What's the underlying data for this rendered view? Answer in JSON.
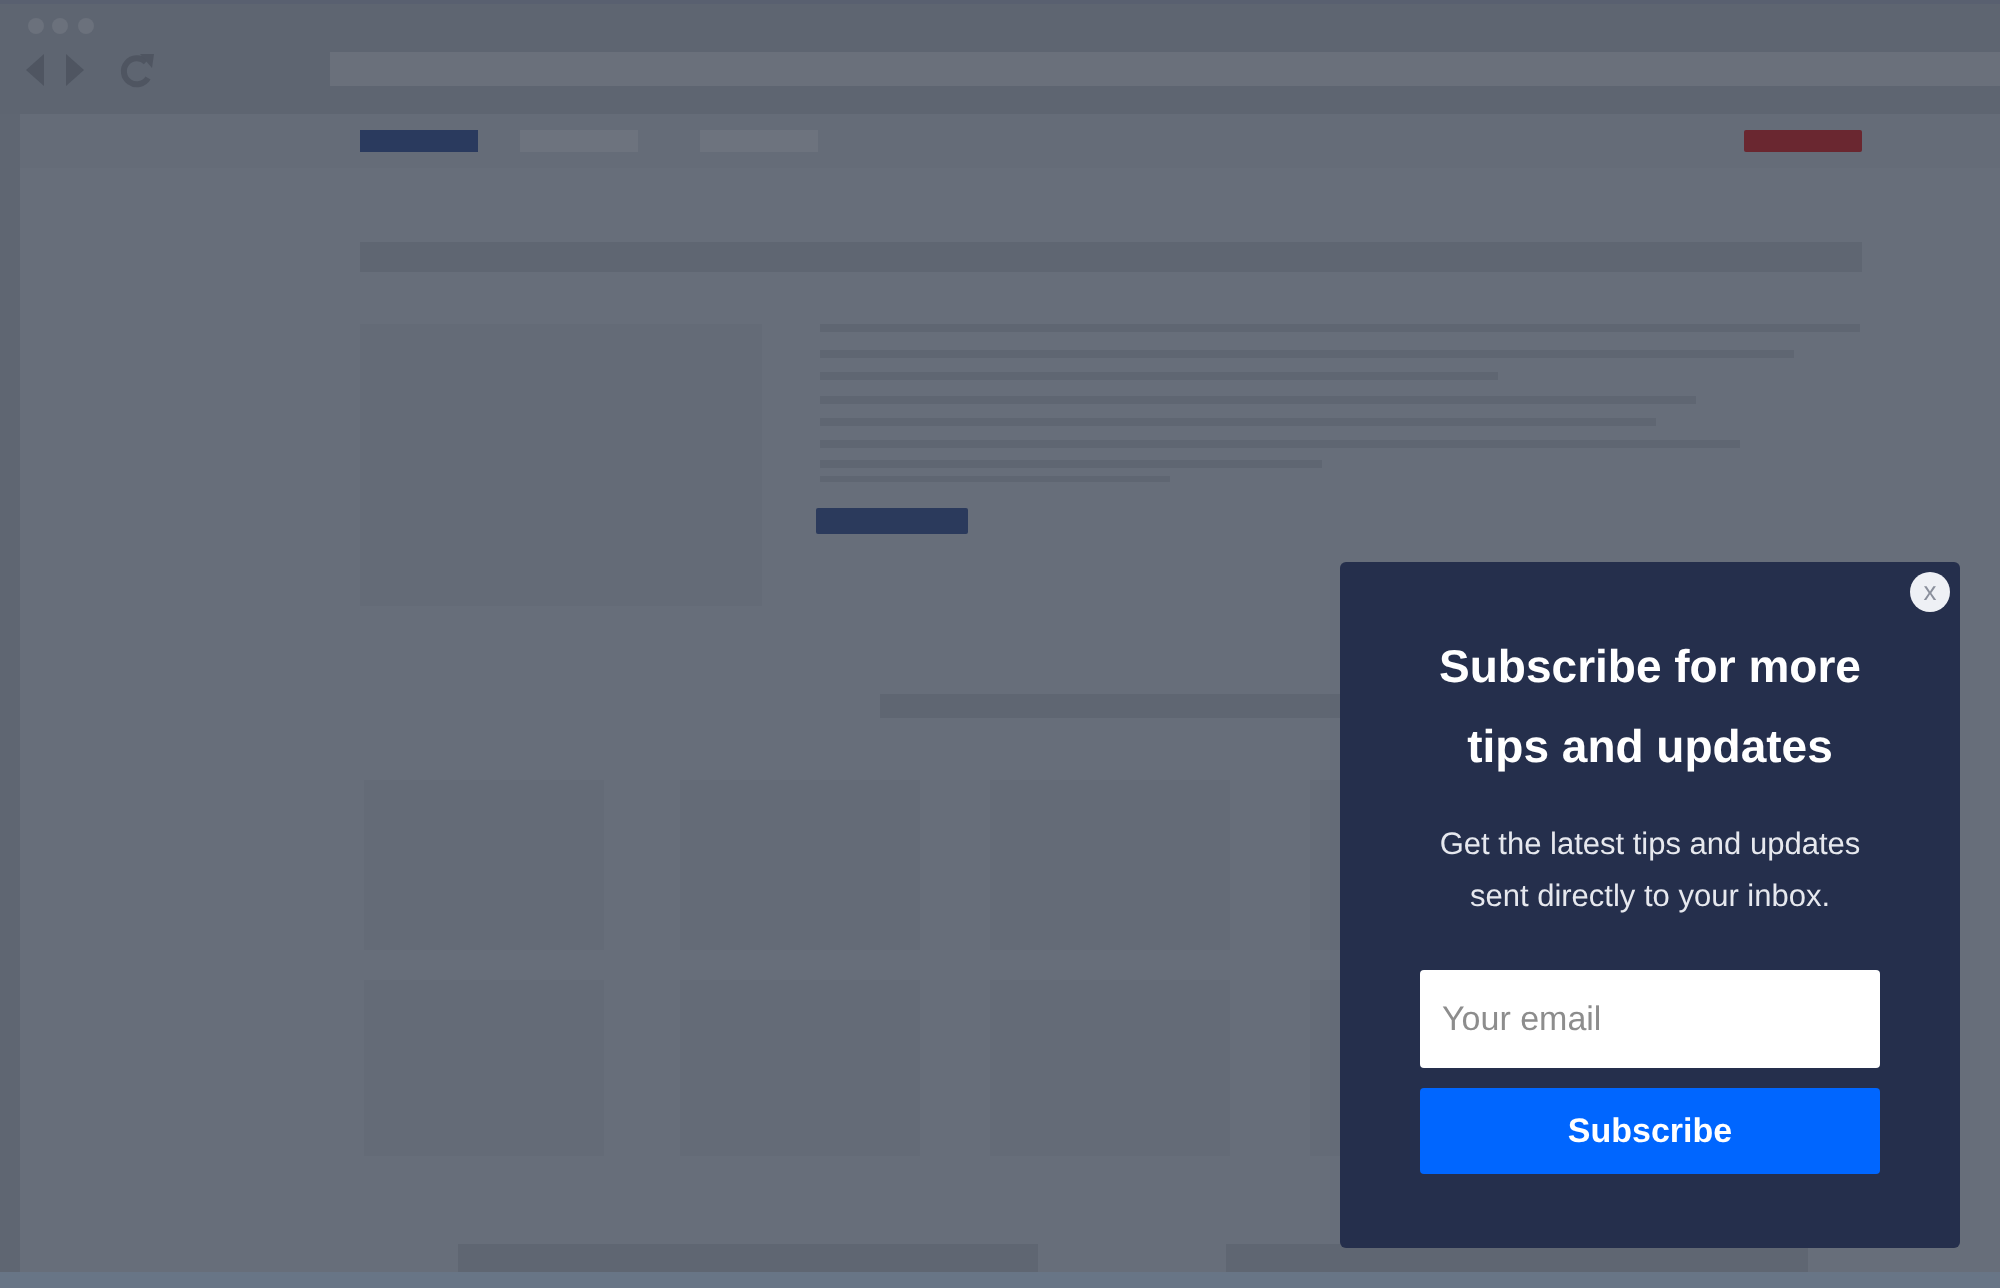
{
  "popup": {
    "close_label": "x",
    "title": "Subscribe for more tips and updates",
    "text": "Get the latest tips and updates sent directly to your inbox.",
    "email_field": {
      "placeholder": "Your email"
    },
    "button": "Subscribe"
  }
}
